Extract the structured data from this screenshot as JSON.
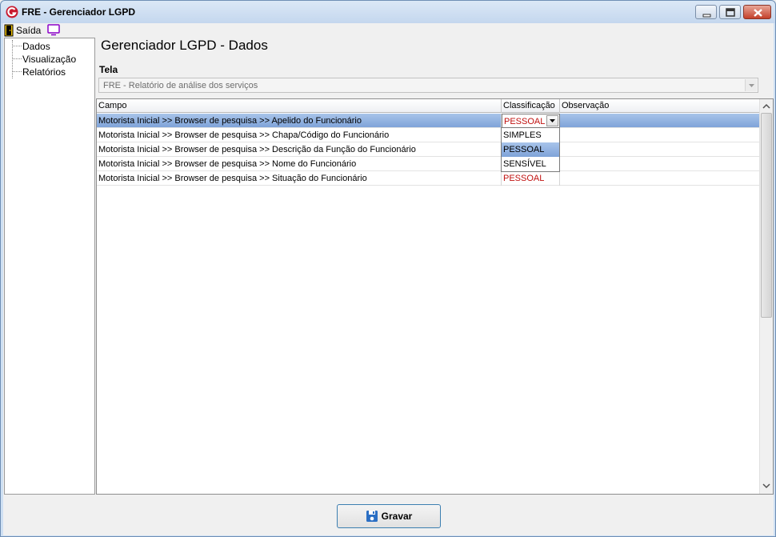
{
  "window": {
    "title": "FRE - Gerenciador LGPD"
  },
  "menu": {
    "exit_label": "Saída",
    "monitor_icon": "monitor-icon"
  },
  "tree": {
    "items": [
      {
        "label": "Dados"
      },
      {
        "label": "Visualização"
      },
      {
        "label": "Relatórios"
      }
    ]
  },
  "page": {
    "title": "Gerenciador LGPD - Dados",
    "tela_label": "Tela",
    "tela_value": "FRE - Relatório de análise dos serviços"
  },
  "grid": {
    "headers": {
      "campo": "Campo",
      "classificacao": "Classificação",
      "observacao": "Observação"
    },
    "rows": [
      {
        "campo": "Motorista Inicial >> Browser de pesquisa >> Apelido do Funcionário",
        "classificacao": "PESSOAL",
        "observacao": ""
      },
      {
        "campo": "Motorista Inicial >> Browser de pesquisa >> Chapa/Código do Funcionário",
        "classificacao": "",
        "observacao": ""
      },
      {
        "campo": "Motorista Inicial >> Browser de pesquisa >> Descrição da Função do Funcionário",
        "classificacao": "",
        "observacao": ""
      },
      {
        "campo": "Motorista Inicial >> Browser de pesquisa >> Nome do Funcionário",
        "classificacao": "",
        "observacao": ""
      },
      {
        "campo": "Motorista Inicial >> Browser de pesquisa >> Situação do Funcionário",
        "classificacao": "PESSOAL",
        "observacao": ""
      }
    ],
    "dropdown_options": [
      "SIMPLES",
      "PESSOAL",
      "SENSÍVEL"
    ],
    "dropdown_highlighted": "PESSOAL"
  },
  "footer": {
    "save_label": "Gravar"
  },
  "colors": {
    "classification_text": "#c0100f",
    "selection": "#7fa3d9",
    "save_border": "#3c7fb1"
  }
}
